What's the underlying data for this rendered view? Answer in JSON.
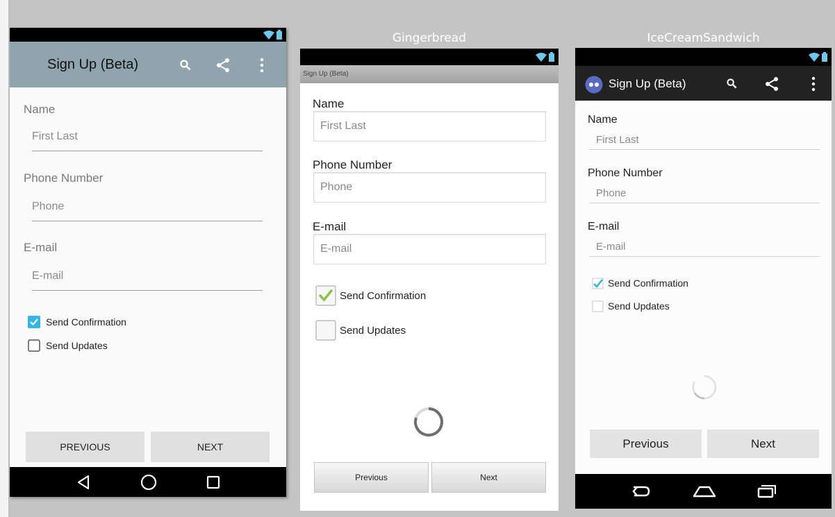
{
  "lollipop": {
    "title": "Sign Up (Beta)",
    "name_label": "Name",
    "name_placeholder": "First Last",
    "phone_label": "Phone Number",
    "phone_placeholder": "Phone",
    "email_label": "E-mail",
    "email_placeholder": "E-mail",
    "cb_confirm": "Send Confirmation",
    "cb_updates": "Send Updates",
    "confirm_checked": true,
    "updates_checked": false,
    "prev": "PREVIOUS",
    "next": "NEXT",
    "icons": [
      "search-icon",
      "share-icon",
      "overflow-menu-icon",
      "back-icon",
      "home-icon",
      "recents-icon"
    ]
  },
  "gingerbread": {
    "caption": "Gingerbread",
    "title": "Sign Up (Beta)",
    "name_label": "Name",
    "name_placeholder": "First Last",
    "phone_label": "Phone Number",
    "phone_placeholder": "Phone",
    "email_label": "E-mail",
    "email_placeholder": "E-mail",
    "cb_confirm": "Send Confirmation",
    "cb_updates": "Send Updates",
    "confirm_checked": true,
    "updates_checked": false,
    "prev": "Previous",
    "next": "Next"
  },
  "ics": {
    "caption": "IceCreamSandwich",
    "title": "Sign Up (Beta)",
    "name_label": "Name",
    "name_placeholder": "First Last",
    "phone_label": "Phone Number",
    "phone_placeholder": "Phone",
    "email_label": "E-mail",
    "email_placeholder": "E-mail",
    "cb_confirm": "Send Confirmation",
    "cb_updates": "Send Updates",
    "confirm_checked": true,
    "updates_checked": false,
    "prev": "Previous",
    "next": "Next"
  },
  "colors": {
    "lollipop_toolbar": "#90a4ae",
    "ics_actionbar": "#222222",
    "holo_blue": "#33b5e5",
    "gingerbread_green": "#8bc34a",
    "backdrop": "#c4c4c4"
  }
}
